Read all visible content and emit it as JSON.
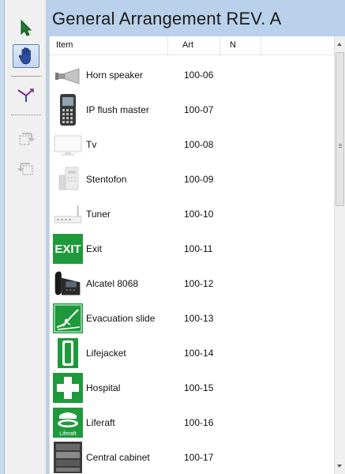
{
  "toolbar": {
    "tools": [
      {
        "name": "select-tool",
        "icon": "arrow-cursor-icon"
      },
      {
        "name": "pan-tool",
        "icon": "hand-icon"
      },
      {
        "name": "connect-tool",
        "icon": "connector-arrow-icon"
      },
      {
        "name": "rotate-right-tool",
        "icon": "rotate-right-icon"
      },
      {
        "name": "rotate-left-tool",
        "icon": "rotate-left-icon"
      }
    ]
  },
  "title": "General Arrangement REV. A",
  "table": {
    "columns": [
      "Item",
      "Art",
      "N"
    ],
    "rows": [
      {
        "icon": "horn-speaker-icon",
        "item": "Horn speaker",
        "art": "100-06"
      },
      {
        "icon": "ip-phone-icon",
        "item": "IP flush master",
        "art": "100-07"
      },
      {
        "icon": "tv-icon",
        "item": "Tv",
        "art": "100-08"
      },
      {
        "icon": "stentofon-icon",
        "item": "Stentofon",
        "art": "100-09"
      },
      {
        "icon": "tuner-icon",
        "item": "Tuner",
        "art": "100-10"
      },
      {
        "icon": "exit-sign-icon",
        "item": "Exit",
        "art": "100-11"
      },
      {
        "icon": "desk-phone-icon",
        "item": "Alcatel 8068",
        "art": "100-12"
      },
      {
        "icon": "evacuation-slide-icon",
        "item": "Evacuation slide",
        "art": "100-13"
      },
      {
        "icon": "lifejacket-icon",
        "item": "Lifejacket",
        "art": "100-14"
      },
      {
        "icon": "hospital-cross-icon",
        "item": "Hospital",
        "art": "100-15"
      },
      {
        "icon": "liferaft-icon",
        "item": "Liferaft",
        "art": "100-16"
      },
      {
        "icon": "cabinet-icon",
        "item": "Central cabinet",
        "art": "100-17"
      }
    ],
    "exit_sign_text": "EXIT",
    "liferaft_sign_text": "Liferaft"
  },
  "colors": {
    "frame": "#b9d1ea",
    "safety_green": "#1e9a3c",
    "selection_blue": "#2b4fa0"
  }
}
